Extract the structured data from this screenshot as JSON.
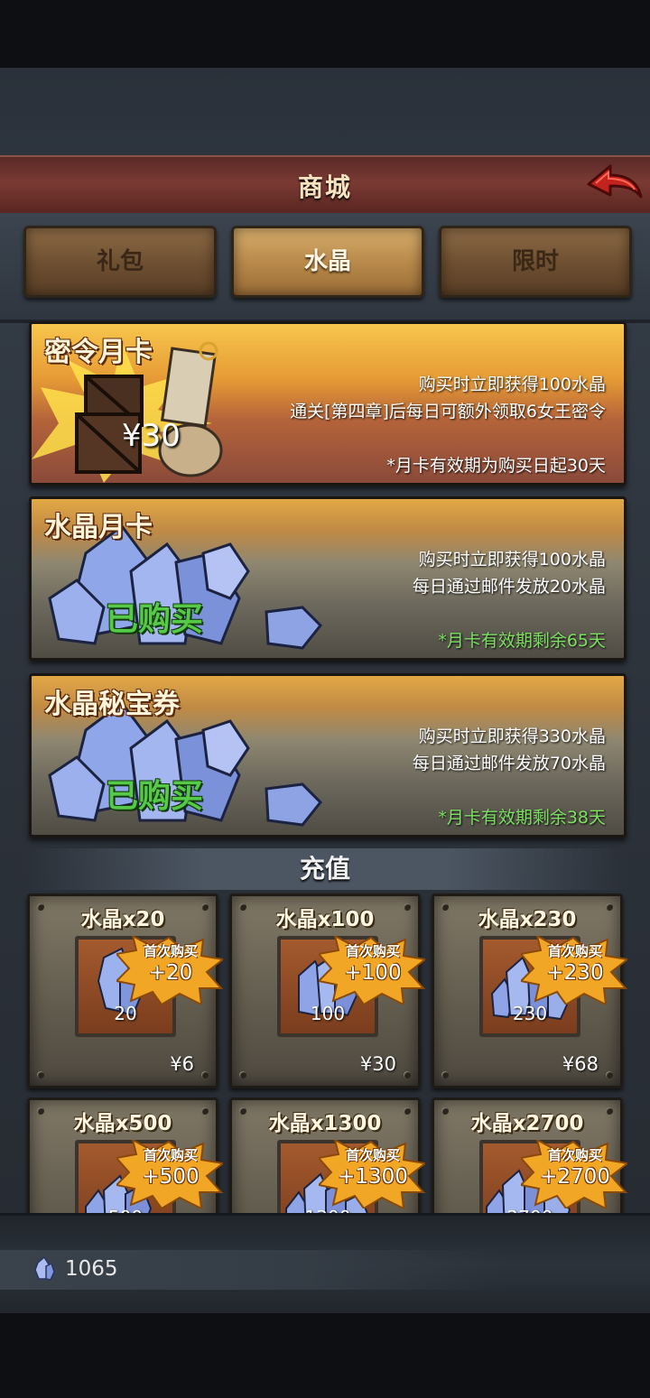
{
  "header": {
    "title": "商城"
  },
  "tabs": [
    {
      "label": "礼包",
      "active": false
    },
    {
      "label": "水晶",
      "active": true
    },
    {
      "label": "限时",
      "active": false
    }
  ],
  "cards": [
    {
      "title": "密令月卡",
      "price": "¥30",
      "lines": [
        "购买时立即获得100水晶",
        "通关[第四章]后每日可额外领取6女王密令"
      ],
      "note": "*月卡有效期为购买日起30天",
      "status": ""
    },
    {
      "title": "水晶月卡",
      "lines": [
        "购买时立即获得100水晶",
        "每日通过邮件发放20水晶"
      ],
      "note": "*月卡有效期剩余65天",
      "status": "已购买"
    },
    {
      "title": "水晶秘宝券",
      "lines": [
        "购买时立即获得330水晶",
        "每日通过邮件发放70水晶"
      ],
      "note": "*月卡有效期剩余38天",
      "status": "已购买"
    }
  ],
  "section": {
    "recharge_label": "充值"
  },
  "packs": [
    {
      "title": "水晶x20",
      "amount": "20",
      "first_label": "首次购买",
      "bonus": "+20",
      "price": "¥6"
    },
    {
      "title": "水晶x100",
      "amount": "100",
      "first_label": "首次购买",
      "bonus": "+100",
      "price": "¥30"
    },
    {
      "title": "水晶x230",
      "amount": "230",
      "first_label": "首次购买",
      "bonus": "+230",
      "price": "¥68"
    },
    {
      "title": "水晶x500",
      "amount": "500",
      "first_label": "首次购买",
      "bonus": "+500",
      "price": ""
    },
    {
      "title": "水晶x1300",
      "amount": "1300",
      "first_label": "首次购买",
      "bonus": "+1300",
      "price": ""
    },
    {
      "title": "水晶x2700",
      "amount": "2700",
      "first_label": "首次购买",
      "bonus": "+2700",
      "price": ""
    }
  ],
  "currency": {
    "icon": "crystal-icon",
    "value": "1065"
  },
  "colors": {
    "purchased_green": "#57c948",
    "note_green": "#7de063",
    "title_bar": "#6e332d"
  }
}
